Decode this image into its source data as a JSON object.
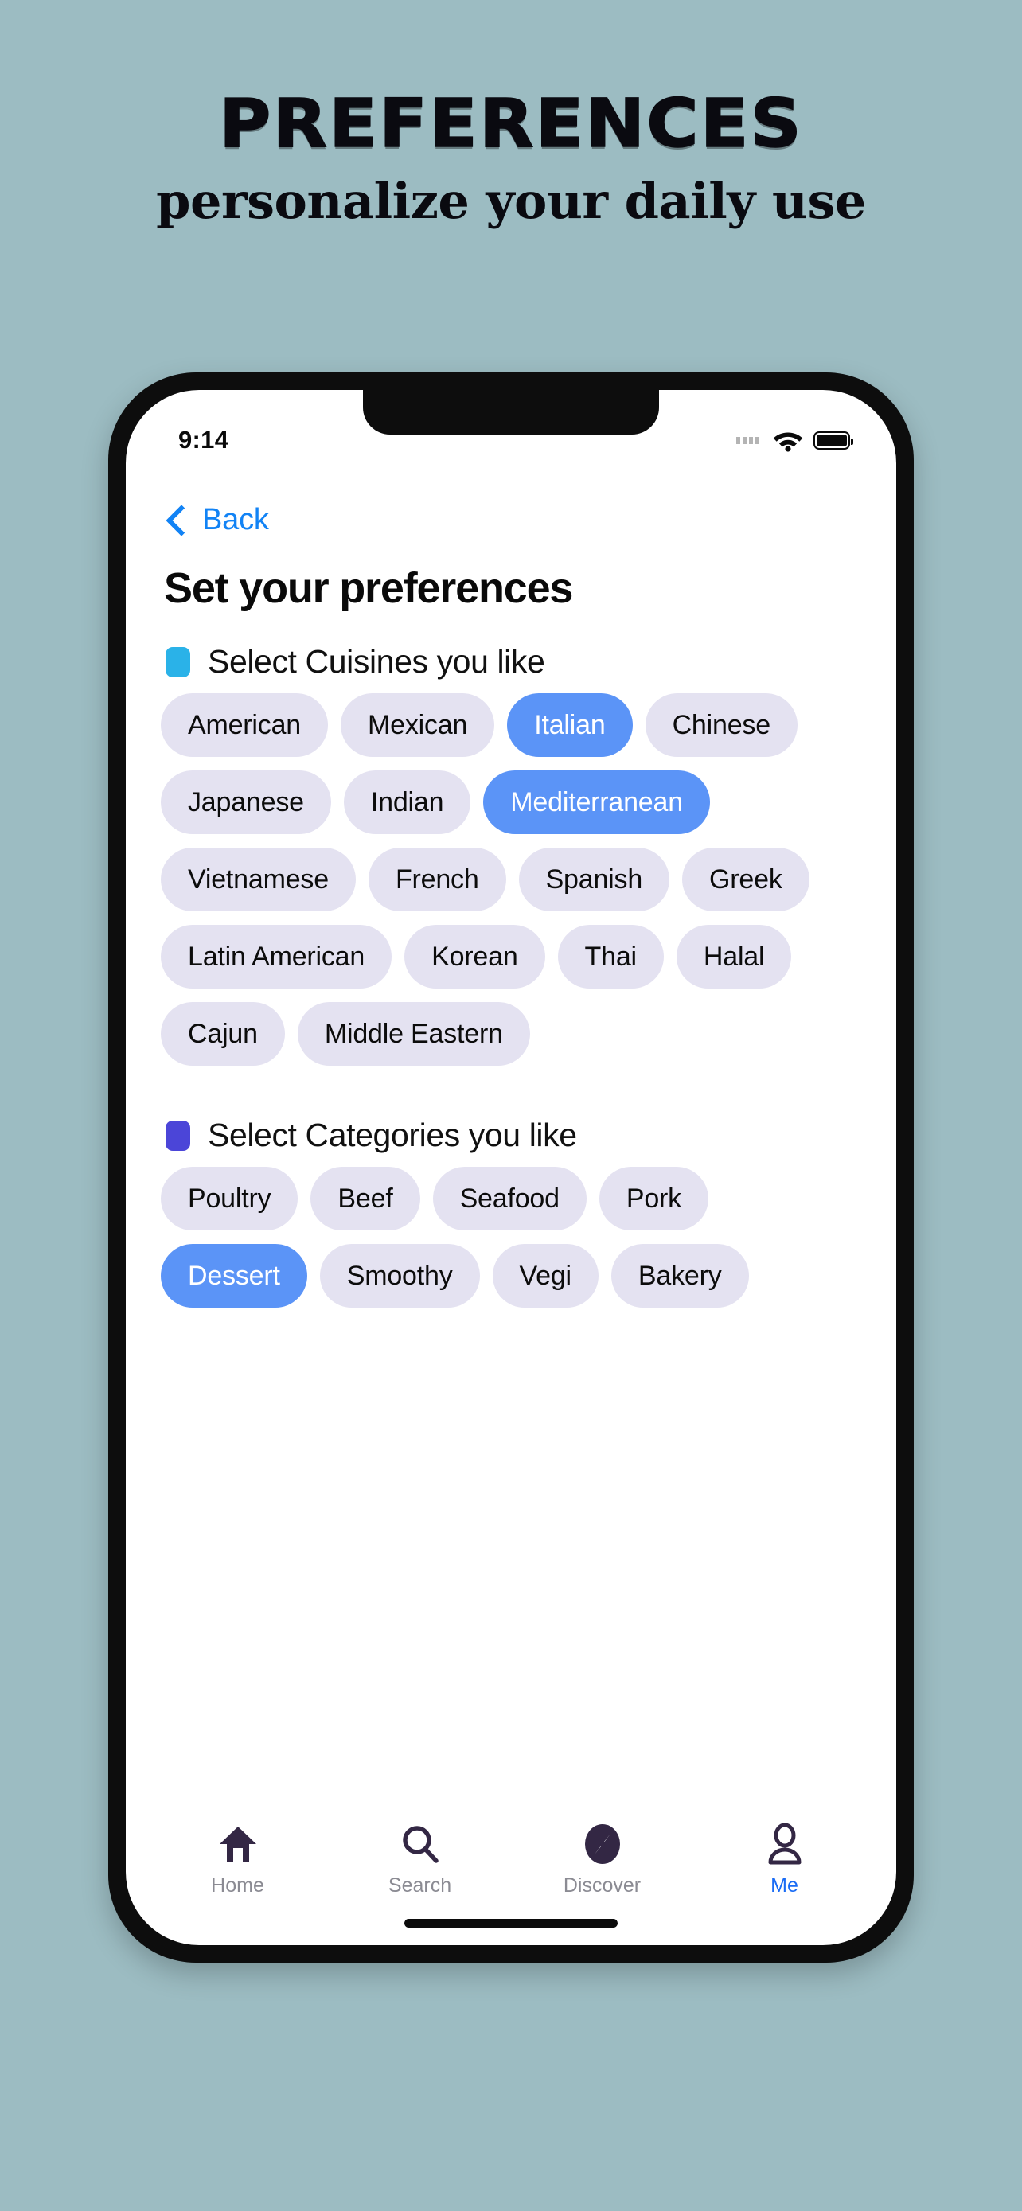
{
  "promo": {
    "title": "PREFERENCES",
    "subtitle": "personalize your daily use"
  },
  "theme": {
    "background": "#9cbcc2",
    "chip_unselected_bg": "#e4e2f1",
    "chip_selected_bg": "#5b94f7",
    "chip_selected_text": "#ffffff",
    "accent_blue": "#1283f5",
    "cuisines_marker": "#2ab2e8",
    "categories_marker": "#4b45d8",
    "tab_icon": "#332744",
    "tab_active": "#1a6cf5"
  },
  "statusbar": {
    "time": "9:14",
    "wifi_icon": "wifi-icon",
    "battery_icon": "battery-icon",
    "signal_icon": "signal-dots-icon"
  },
  "nav": {
    "back_label": "Back",
    "back_icon": "chevron-left-icon"
  },
  "page": {
    "title": "Set your preferences"
  },
  "sections": [
    {
      "id": "cuisines",
      "title": "Select Cuisines you like",
      "marker_color": "#2ab2e8",
      "chips": [
        {
          "label": "American",
          "selected": false
        },
        {
          "label": "Mexican",
          "selected": false
        },
        {
          "label": "Italian",
          "selected": true
        },
        {
          "label": "Chinese",
          "selected": false
        },
        {
          "label": "Japanese",
          "selected": false
        },
        {
          "label": "Indian",
          "selected": false
        },
        {
          "label": "Mediterranean",
          "selected": true
        },
        {
          "label": "Vietnamese",
          "selected": false
        },
        {
          "label": "French",
          "selected": false
        },
        {
          "label": "Spanish",
          "selected": false
        },
        {
          "label": "Greek",
          "selected": false
        },
        {
          "label": "Latin American",
          "selected": false
        },
        {
          "label": "Korean",
          "selected": false
        },
        {
          "label": "Thai",
          "selected": false
        },
        {
          "label": "Halal",
          "selected": false
        },
        {
          "label": "Cajun",
          "selected": false
        },
        {
          "label": "Middle Eastern",
          "selected": false
        }
      ]
    },
    {
      "id": "categories",
      "title": "Select Categories you like",
      "marker_color": "#4b45d8",
      "chips": [
        {
          "label": "Poultry",
          "selected": false
        },
        {
          "label": "Beef",
          "selected": false
        },
        {
          "label": "Seafood",
          "selected": false
        },
        {
          "label": "Pork",
          "selected": false
        },
        {
          "label": "Dessert",
          "selected": true
        },
        {
          "label": "Smoothy",
          "selected": false
        },
        {
          "label": "Vegi",
          "selected": false
        },
        {
          "label": "Bakery",
          "selected": false
        }
      ]
    }
  ],
  "tabbar": {
    "items": [
      {
        "label": "Home",
        "icon": "home-icon",
        "active": false
      },
      {
        "label": "Search",
        "icon": "search-icon",
        "active": false
      },
      {
        "label": "Discover",
        "icon": "compass-icon",
        "active": false
      },
      {
        "label": "Me",
        "icon": "person-icon",
        "active": true
      }
    ]
  }
}
